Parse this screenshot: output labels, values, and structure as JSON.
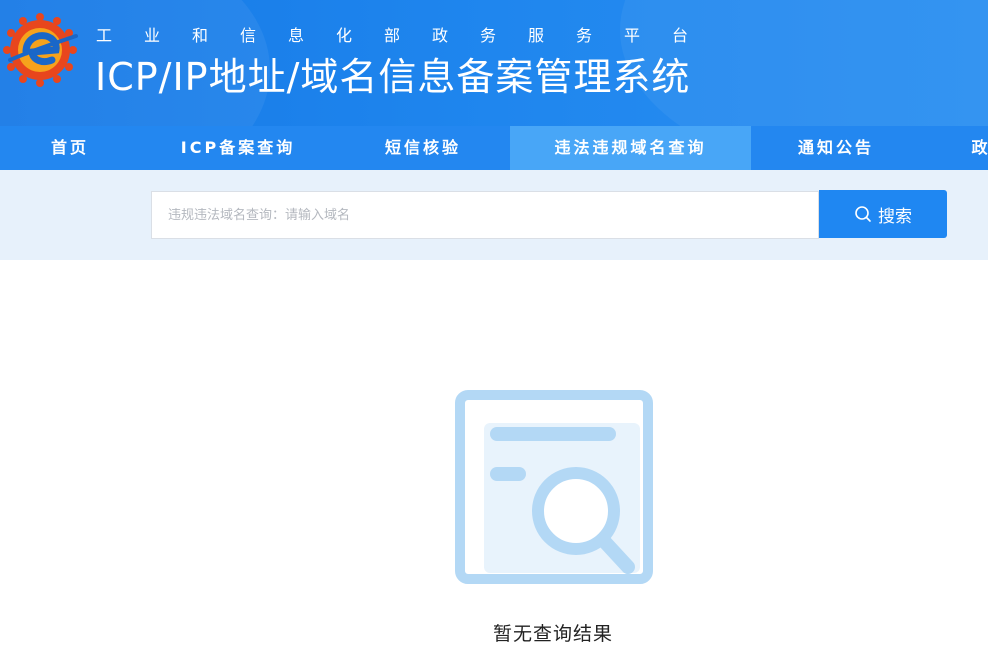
{
  "header": {
    "subtitle": "工业和信息化部政务服务平台",
    "title": "ICP/IP地址/域名信息备案管理系统"
  },
  "nav": {
    "items": [
      {
        "label": "首页",
        "active": false
      },
      {
        "label": "ICP备案查询",
        "active": false
      },
      {
        "label": "短信核验",
        "active": false
      },
      {
        "label": "违法违规域名查询",
        "active": true
      },
      {
        "label": "通知公告",
        "active": false
      },
      {
        "label": "政",
        "active": false
      }
    ]
  },
  "search": {
    "placeholder": "违规违法域名查询：请输入域名",
    "value": "",
    "button_label": "搜索"
  },
  "empty_state": {
    "message": "暂无查询结果",
    "icon": "search-document-icon"
  },
  "colors": {
    "header_bg": "#1f86ee",
    "nav_bg": "#2387f0",
    "nav_active_bg": "#48a6f7",
    "search_band_bg": "#e7f1fb",
    "button_bg": "#1f87f2",
    "illustration": "#b3d8f5"
  }
}
